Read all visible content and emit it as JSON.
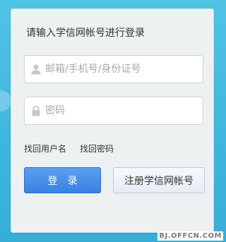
{
  "form": {
    "title": "请输入学信网帐号进行登录",
    "username": {
      "placeholder": "邮箱/手机号/身份证号",
      "value": "",
      "icon": "user-icon"
    },
    "password": {
      "placeholder": "密码",
      "value": "",
      "icon": "lock-icon"
    },
    "links": {
      "recover_username": "找回用户名",
      "recover_password": "找回密码"
    },
    "buttons": {
      "login": "登录",
      "register": "注册学信网帐号"
    }
  },
  "watermark": "BJ.OFFCN.COM",
  "colors": {
    "background": "#45bde1",
    "panel": "#eef1f2",
    "primary": "#3a82e2",
    "icon": "#c8c8c8"
  }
}
